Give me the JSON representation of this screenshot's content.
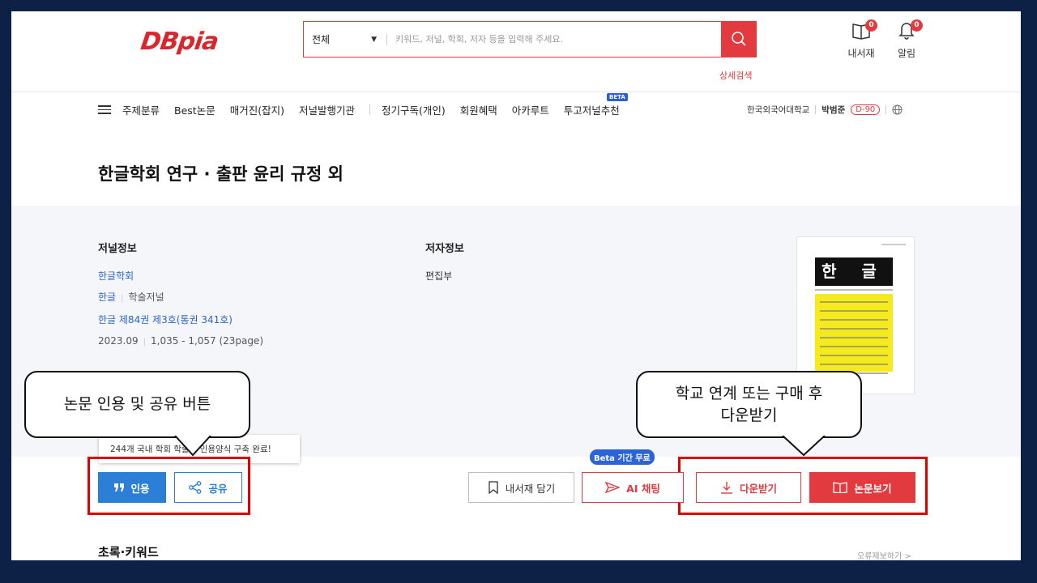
{
  "header": {
    "logo": "DBpia",
    "search": {
      "category": "전체",
      "placeholder": "키워드, 저널, 학회, 저자 등을 입력해 주세요."
    },
    "advanced_search": "상세검색",
    "library": {
      "label": "내서재",
      "count": "0"
    },
    "alerts": {
      "label": "알림",
      "count": "0"
    }
  },
  "nav": {
    "items": [
      "주제분류",
      "Best논문",
      "매거진(잡지)",
      "저널발행기관",
      "정기구독(개인)",
      "회원혜택",
      "아카루트",
      "투고저널추천"
    ],
    "beta_badge": "BETA",
    "institution": "한국외국어대학교",
    "user_name": "박범준",
    "dday": "D-90"
  },
  "article": {
    "title": "한글학회 연구 · 출판 윤리 규정 외",
    "journal_heading": "저널정보",
    "publisher": "한글학회",
    "journal_name": "한글",
    "journal_type": "학술저널",
    "issue": "한글 제84권 제3호(통권 341호)",
    "date": "2023.09",
    "pages": "1,035 - 1,057 (23page)",
    "author_heading": "저자정보",
    "author": "편집부",
    "cover_title": "한 글"
  },
  "annotations": {
    "left_callout": "논문 인용 및 공유 버튼",
    "right_callout_line1": "학교 연계 또는 구매 후",
    "right_callout_line2": "다운받기"
  },
  "tooltip": "244개 국내 학회 학술지 인용양식 구축 완료!",
  "actions": {
    "cite": "인용",
    "share": "공유",
    "save": "내서재 담기",
    "ai_chat": "AI 채팅",
    "beta_free": "Beta 기간 무료",
    "download": "다운받기",
    "view": "논문보기"
  },
  "section": {
    "abstract_heading": "초록·키워드",
    "report_error": "오류제보하기 >"
  },
  "colors": {
    "brand_red": "#e23a3f",
    "link_blue": "#2b63c6",
    "cite_blue": "#2b7fd6",
    "frame": "#0d2147"
  }
}
